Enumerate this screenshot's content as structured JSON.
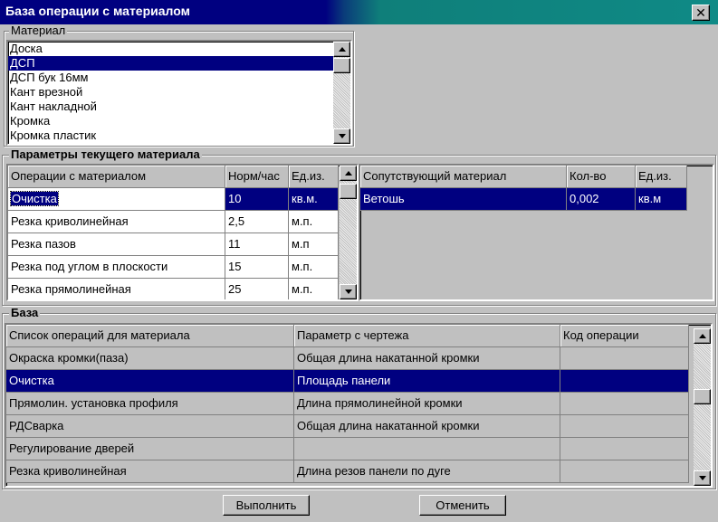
{
  "window": {
    "title": "База операции с материалом"
  },
  "material_group": {
    "label": "Материал",
    "items": [
      "Доска",
      "ДСП",
      "ДСП бук 16мм",
      "Кант врезной",
      "Кант накладной",
      "Кромка",
      "Кромка пластик"
    ],
    "selected_index": 1
  },
  "params_group": {
    "label": "Параметры текущего материала",
    "operations_table": {
      "headers": [
        "Операции с материалом",
        "Норм/час",
        "Ед.из."
      ],
      "rows": [
        [
          "Очистка",
          "10",
          "кв.м."
        ],
        [
          "Резка криволинейная",
          "2,5",
          "м.п."
        ],
        [
          "Резка пазов",
          "11",
          "м.п"
        ],
        [
          "Резка под углом в плоскости",
          "15",
          "м.п."
        ],
        [
          "Резка прямолинейная",
          "25",
          "м.п."
        ]
      ]
    },
    "accompanying_table": {
      "headers": [
        "Сопутствующий материал",
        "Кол-во",
        "Ед.из."
      ],
      "rows": [
        [
          "Ветошь",
          "0,002",
          "кв.м"
        ]
      ]
    }
  },
  "base_group": {
    "label": "База",
    "table": {
      "headers": [
        "Список операций для материала",
        "Параметр с чертежа",
        "Код операции"
      ],
      "rows": [
        [
          "Окраска кромки(паза)",
          "Общая длина накатанной кромки",
          ""
        ],
        [
          "Очистка",
          "Площадь панели",
          ""
        ],
        [
          "Прямолин. установка профиля",
          "Длина прямолинейной кромки",
          ""
        ],
        [
          "РДСварка",
          "Общая длина накатанной кромки",
          ""
        ],
        [
          "Регулирование дверей",
          "",
          ""
        ],
        [
          "Резка криволинейная",
          "Длина резов панели по дуге",
          ""
        ]
      ],
      "selected_index": 1
    }
  },
  "buttons": {
    "execute": "Выполнить",
    "cancel": "Отменить"
  },
  "icons": {
    "close": "close-icon",
    "scroll_up": "arrow-up-icon",
    "scroll_down": "arrow-down-icon"
  },
  "colors": {
    "selection": "#000080",
    "title_start": "#000080",
    "title_end": "#0f8a86",
    "face": "#c0c0c0"
  }
}
